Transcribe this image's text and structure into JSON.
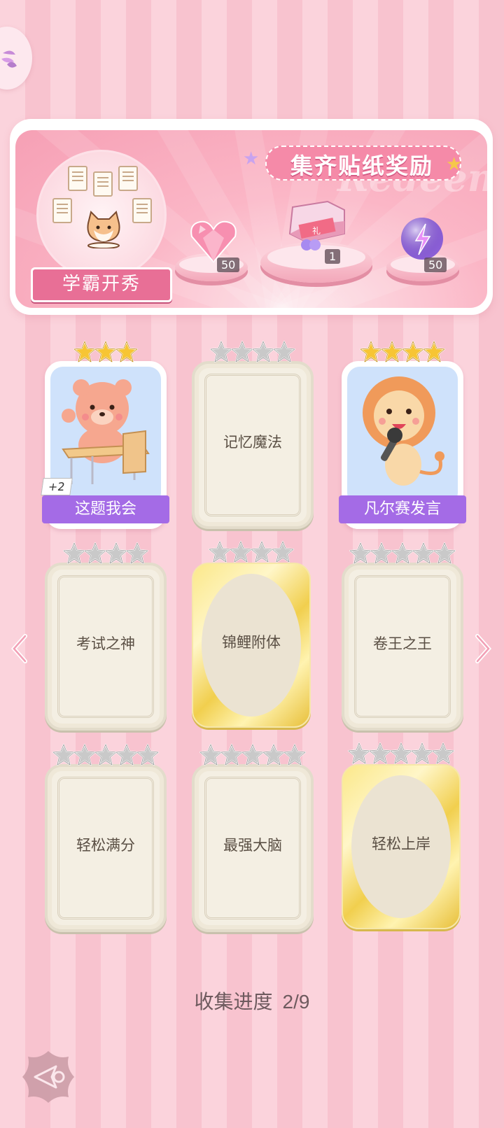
{
  "banner": {
    "title": "集齐贴纸奖励",
    "watermark": "Redeem",
    "theme_name": "学霸开秀",
    "rewards": [
      {
        "icon": "pink-heart-diamond-icon",
        "count": "50"
      },
      {
        "icon": "gift-box-icon",
        "count": "1"
      },
      {
        "icon": "lightning-orb-icon",
        "count": "50"
      }
    ]
  },
  "cards": [
    {
      "name": "这题我会",
      "state": "owned",
      "stars": 3,
      "star_color": "gold",
      "badge": "+2",
      "art": "bear-at-desk"
    },
    {
      "name": "记忆魔法",
      "state": "locked",
      "stars": 4,
      "star_color": "silver"
    },
    {
      "name": "凡尔赛发言",
      "state": "owned",
      "stars": 4,
      "star_color": "gold",
      "art": "lion-with-microphone"
    },
    {
      "name": "考试之神",
      "state": "locked",
      "stars": 4,
      "star_color": "silver"
    },
    {
      "name": "锦鲤附体",
      "state": "gold",
      "stars": 4,
      "star_color": "silver"
    },
    {
      "name": "卷王之王",
      "state": "locked",
      "stars": 5,
      "star_color": "silver"
    },
    {
      "name": "轻松满分",
      "state": "locked",
      "stars": 5,
      "star_color": "silver"
    },
    {
      "name": "最强大脑",
      "state": "locked",
      "stars": 5,
      "star_color": "silver"
    },
    {
      "name": "轻松上岸",
      "state": "gold",
      "stars": 5,
      "star_color": "silver"
    }
  ],
  "progress": {
    "label": "收集进度",
    "value": "2/9",
    "collected": 2,
    "total": 9
  },
  "colors": {
    "gold_star": "#f7c534",
    "silver_star": "#c9c9c9",
    "ribbon_purple": "#a46be6",
    "theme_pink": "#e86f96"
  }
}
